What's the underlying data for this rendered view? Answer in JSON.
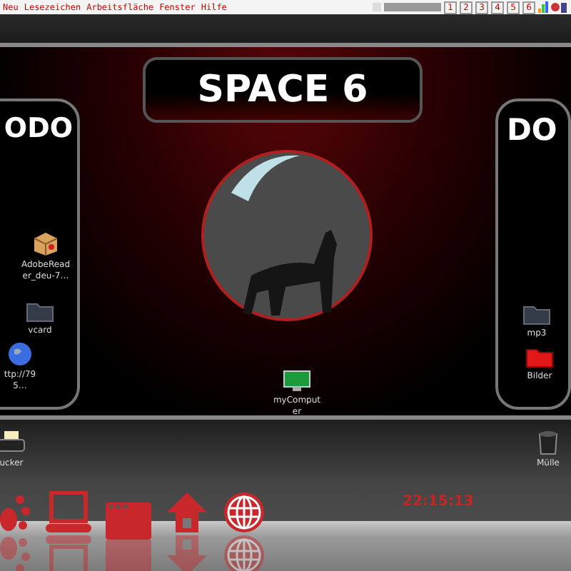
{
  "menu_bar": {
    "items": [
      "Neu",
      "Lesezeichen",
      "Arbeitsfläche",
      "Fenster",
      "Hilfe"
    ]
  },
  "pager": [
    "1",
    "2",
    "3",
    "4",
    "5",
    "6"
  ],
  "desktop_title": "SPACE 6",
  "panels": [
    {
      "title": "ODO"
    },
    {
      "title": "DO"
    }
  ],
  "desktop_icons": [
    {
      "label": "AdobeReader_deu-7…",
      "kind": "package"
    },
    {
      "label": "vcard",
      "kind": "folder"
    },
    {
      "label": "ttp://795…",
      "kind": "globe"
    },
    {
      "label": "mp3",
      "kind": "folder"
    },
    {
      "label": "Bilder",
      "kind": "red-folder"
    },
    {
      "label": "myComputer",
      "kind": "monitor"
    },
    {
      "label": "ucker",
      "kind": "printer"
    },
    {
      "label": "Mülle",
      "kind": "trash"
    }
  ],
  "dock": [
    {
      "kind": "paw"
    },
    {
      "kind": "laptop"
    },
    {
      "kind": "window"
    },
    {
      "kind": "house"
    },
    {
      "kind": "globe"
    }
  ],
  "clock": {
    "time": "22:15:13"
  }
}
